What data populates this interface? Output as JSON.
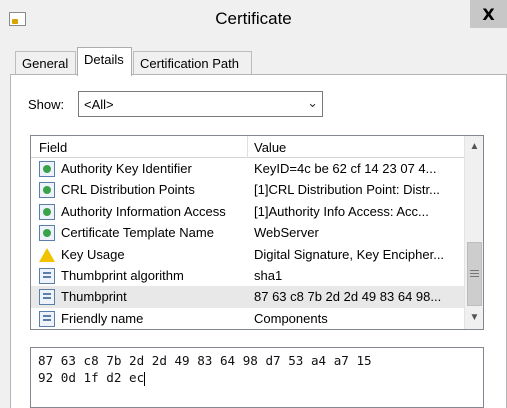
{
  "window": {
    "title": "Certificate",
    "close_label": "X"
  },
  "tabs": [
    {
      "label": "General",
      "active": false
    },
    {
      "label": "Details",
      "active": true
    },
    {
      "label": "Certification Path",
      "active": false
    }
  ],
  "show": {
    "label": "Show:",
    "value": "<All>"
  },
  "grid": {
    "columns": [
      "Field",
      "Value"
    ],
    "rows": [
      {
        "icon": "certificate-extension-icon",
        "field": "Authority Key Identifier",
        "value": "KeyID=4c be 62 cf 14 23 07 4...",
        "selected": false
      },
      {
        "icon": "certificate-extension-icon",
        "field": "CRL Distribution Points",
        "value": "[1]CRL Distribution Point: Distr...",
        "selected": false
      },
      {
        "icon": "certificate-extension-icon",
        "field": "Authority Information Access",
        "value": "[1]Authority Info Access: Acc...",
        "selected": false
      },
      {
        "icon": "certificate-extension-icon",
        "field": "Certificate Template Name",
        "value": "WebServer",
        "selected": false
      },
      {
        "icon": "warning-icon",
        "field": "Key Usage",
        "value": "Digital Signature, Key Encipher...",
        "selected": false
      },
      {
        "icon": "property-icon",
        "field": "Thumbprint algorithm",
        "value": "sha1",
        "selected": false
      },
      {
        "icon": "property-icon",
        "field": "Thumbprint",
        "value": "87 63 c8 7b 2d 2d 49 83 64 98...",
        "selected": true
      },
      {
        "icon": "property-icon",
        "field": "Friendly name",
        "value": "Components",
        "selected": false
      }
    ]
  },
  "detail": {
    "line1": "87 63 c8 7b 2d 2d 49 83 64 98 d7 53 a4 a7 15",
    "line2": "92 0d 1f d2 ec"
  }
}
